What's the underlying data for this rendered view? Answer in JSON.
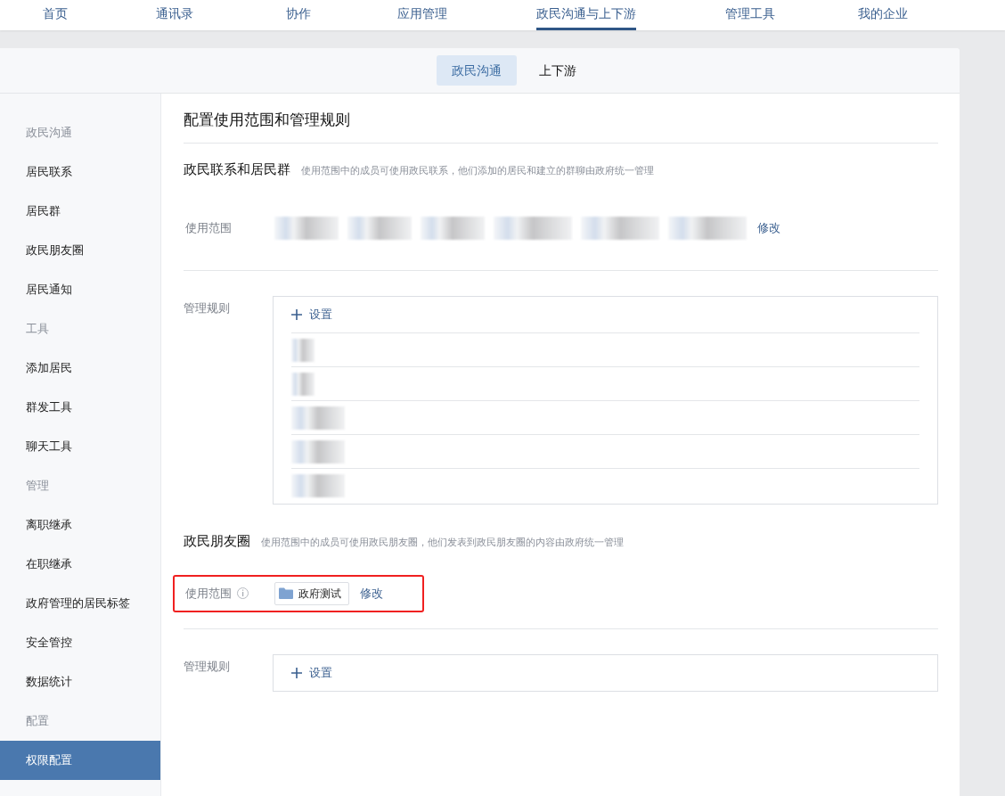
{
  "top_nav": [
    {
      "label": "首页",
      "selected": false
    },
    {
      "label": "通讯录",
      "selected": false
    },
    {
      "label": "协作",
      "selected": false
    },
    {
      "label": "应用管理",
      "selected": false
    },
    {
      "label": "政民沟通与上下游",
      "selected": true
    },
    {
      "label": "管理工具",
      "selected": false
    },
    {
      "label": "我的企业",
      "selected": false
    }
  ],
  "sub_tabs": [
    {
      "label": "政民沟通",
      "selected": true
    },
    {
      "label": "上下游",
      "selected": false
    }
  ],
  "sidebar": {
    "items": [
      {
        "kind": "group",
        "label": "政民沟通"
      },
      {
        "kind": "item",
        "label": "居民联系",
        "selected": false
      },
      {
        "kind": "item",
        "label": "居民群",
        "selected": false
      },
      {
        "kind": "item",
        "label": "政民朋友圈",
        "selected": false
      },
      {
        "kind": "item",
        "label": "居民通知",
        "selected": false
      },
      {
        "kind": "group",
        "label": "工具"
      },
      {
        "kind": "item",
        "label": "添加居民",
        "selected": false
      },
      {
        "kind": "item",
        "label": "群发工具",
        "selected": false
      },
      {
        "kind": "item",
        "label": "聊天工具",
        "selected": false
      },
      {
        "kind": "group",
        "label": "管理"
      },
      {
        "kind": "item",
        "label": "离职继承",
        "selected": false
      },
      {
        "kind": "item",
        "label": "在职继承",
        "selected": false
      },
      {
        "kind": "item",
        "label": "政府管理的居民标签",
        "selected": false
      },
      {
        "kind": "item",
        "label": "安全管控",
        "selected": false
      },
      {
        "kind": "item",
        "label": "数据统计",
        "selected": false
      },
      {
        "kind": "group",
        "label": "配置"
      },
      {
        "kind": "item",
        "label": "权限配置",
        "selected": true
      }
    ]
  },
  "page_title": "配置使用范围和管理规则",
  "sections": [
    {
      "title": "政民联系和居民群",
      "description": "使用范围中的成员可使用政民联系，他们添加的居民和建立的群聊由政府统一管理",
      "scope": {
        "label": "使用范围",
        "info_icon": false,
        "highlighted": false,
        "tags": [
          {
            "kind": "blurred"
          },
          {
            "kind": "blurred"
          },
          {
            "kind": "blurred"
          },
          {
            "kind": "blurred"
          },
          {
            "kind": "blurred"
          },
          {
            "kind": "blurred"
          }
        ],
        "edit_link": "修改"
      },
      "rules": {
        "label": "管理规则",
        "add_button": "设置",
        "rows": [
          {
            "kind": "blurred"
          },
          {
            "kind": "blurred"
          },
          {
            "kind": "blurred"
          },
          {
            "kind": "blurred"
          },
          {
            "kind": "blurred"
          }
        ]
      }
    },
    {
      "title": "政民朋友圈",
      "description": "使用范围中的成员可使用政民朋友圈，他们发表到政民朋友圈的内容由政府统一管理",
      "scope": {
        "label": "使用范围",
        "info_icon": true,
        "highlighted": true,
        "tags": [
          {
            "kind": "folder",
            "label": "政府测试"
          }
        ],
        "edit_link": "修改"
      },
      "rules": {
        "label": "管理规则",
        "add_button": "设置"
      }
    }
  ]
}
